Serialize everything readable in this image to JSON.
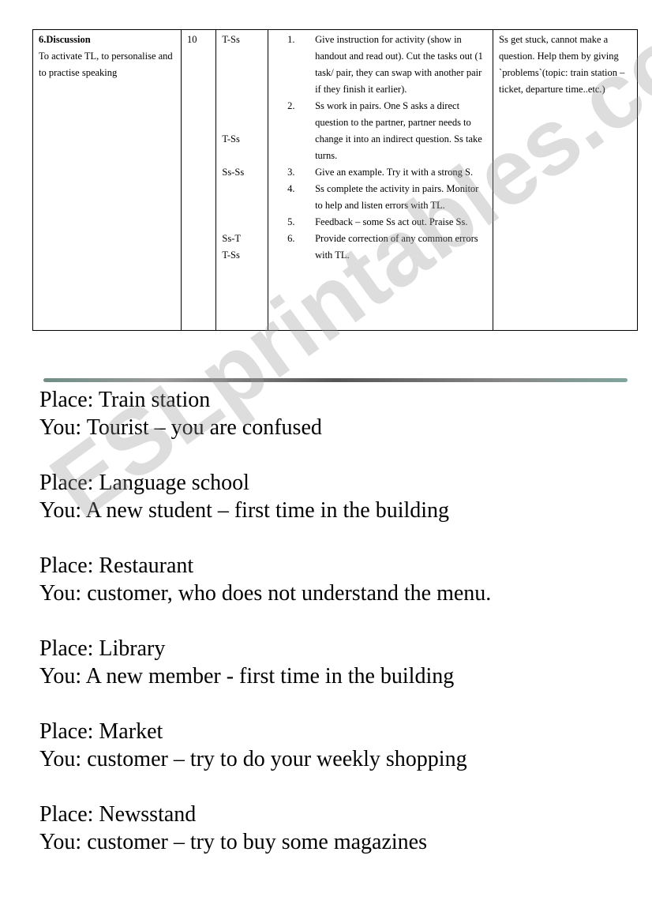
{
  "table": {
    "stage_title": "6.Discussion",
    "stage_aim": "To activate TL, to personalise and to practise speaking",
    "time": "10",
    "interaction": [
      "T-Ss",
      "",
      "",
      "",
      "",
      "",
      "T-Ss",
      "",
      "Ss-Ss",
      "",
      "",
      "",
      "Ss-T",
      "T-Ss"
    ],
    "steps": [
      {
        "num": "1.",
        "text": "Give instruction for activity (show in handout and read out).  Cut the tasks out (1 task/ pair, they can swap with another pair if they finish it earlier)."
      },
      {
        "num": "2.",
        "text": "Ss work in pairs. One S asks a direct question to the partner, partner needs to change it into an indirect question. Ss take turns."
      },
      {
        "num": "3.",
        "text": "Give an example. Try it with a strong S."
      },
      {
        "num": "4.",
        "text": "Ss complete the activity in pairs. Monitor to help and listen errors with TL."
      },
      {
        "num": "5.",
        "text": "Feedback – some Ss act out. Praise Ss."
      },
      {
        "num": "6.",
        "text": "Provide correction of any common errors with TL."
      }
    ],
    "problems": "Ss get stuck, cannot make a question. Help them by giving `problems`(topic: train station – ticket, departure time..etc.)"
  },
  "tasks": [
    {
      "place": "Place: Train station",
      "you": "You: Tourist – you are confused"
    },
    {
      "place": "Place: Language school",
      "you": "You: A new student – first time in the building"
    },
    {
      "place": "Place: Restaurant",
      "you": "You: customer, who does not understand the menu."
    },
    {
      "place": "Place: Library",
      "you": "You: A new member - first time in the building"
    },
    {
      "place": "Place: Market",
      "you": "You: customer – try to do your weekly shopping"
    },
    {
      "place": "Place: Newsstand",
      "you": "You: customer – try to buy some magazines"
    }
  ],
  "watermark": "ESLprintables.com"
}
